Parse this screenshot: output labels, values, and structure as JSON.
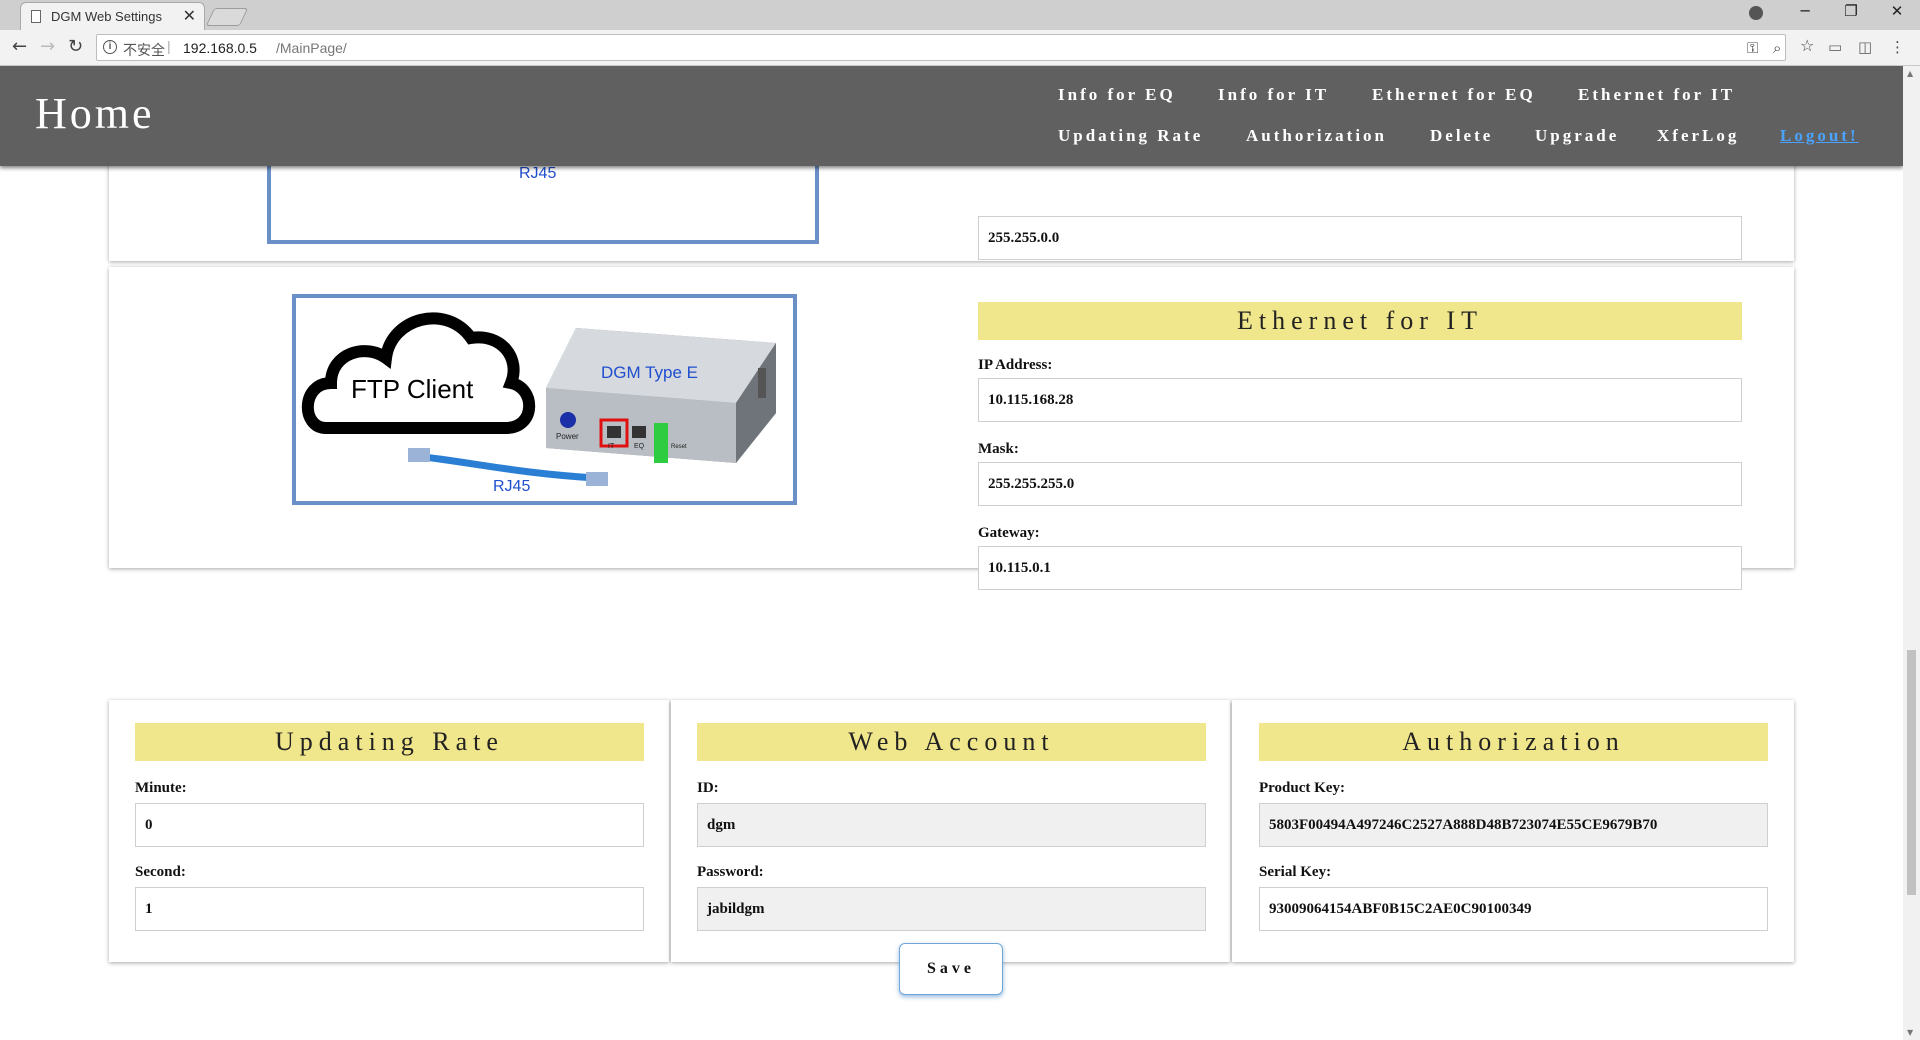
{
  "browser": {
    "tab_title": "DGM Web Settings",
    "tab_close": "✕",
    "security_label": "不安全",
    "separator": "|",
    "url_host": "192.168.0.5",
    "url_path": "/MainPage/",
    "window_controls": {
      "minimize": "─",
      "restore": "❐",
      "close": "✕"
    }
  },
  "header": {
    "title": "Home",
    "nav_row1": [
      "Info for EQ",
      "Info for IT",
      "Ethernet for EQ",
      "Ethernet for IT"
    ],
    "nav_row2": [
      "Updating Rate",
      "Authorization",
      "Delete",
      "Upgrade",
      "XferLog"
    ],
    "logout": "Logout!"
  },
  "eq_section": {
    "image_label": "RJ45",
    "mask_value": "255.255.0.0"
  },
  "ethernet_it": {
    "heading": "Ethernet for IT",
    "ip_label": "IP Address:",
    "ip_value": "10.115.168.28",
    "mask_label": "Mask:",
    "mask_value": "255.255.255.0",
    "gateway_label": "Gateway:",
    "gateway_value": "10.115.0.1",
    "diagram": {
      "cloud_text": "FTP Client",
      "device_text": "DGM Type E",
      "power_label": "Power",
      "it_label": "IT",
      "eq_label": "EQ",
      "reset_label": "Reset",
      "cable_label": "RJ45"
    }
  },
  "updating_rate": {
    "heading": "Updating Rate",
    "minute_label": "Minute:",
    "minute_value": "0",
    "second_label": "Second:",
    "second_value": "1"
  },
  "web_account": {
    "heading": "Web Account",
    "id_label": "ID:",
    "id_value": "dgm",
    "password_label": "Password:",
    "password_value": "jabildgm"
  },
  "authorization": {
    "heading": "Authorization",
    "product_key_label": "Product Key:",
    "product_key_value": "5803F00494A497246C2527A888D48B723074E55CE9679B70",
    "serial_key_label": "Serial Key:",
    "serial_key_value": "93009064154ABF0B15C2AE0C90100349"
  },
  "save_label": "Save",
  "colors": {
    "header_bg": "#606060",
    "heading_bg": "#f0e68c",
    "frame_border": "#6b8fc7",
    "logout_link": "#4aa3ff"
  },
  "icons": [
    "doc-icon",
    "back-arrow-icon",
    "forward-arrow-icon",
    "reload-icon",
    "info-icon",
    "key-icon",
    "zoom-icon",
    "star-icon",
    "cast-icon",
    "extension-icon",
    "menu-icon",
    "profile-icon"
  ]
}
